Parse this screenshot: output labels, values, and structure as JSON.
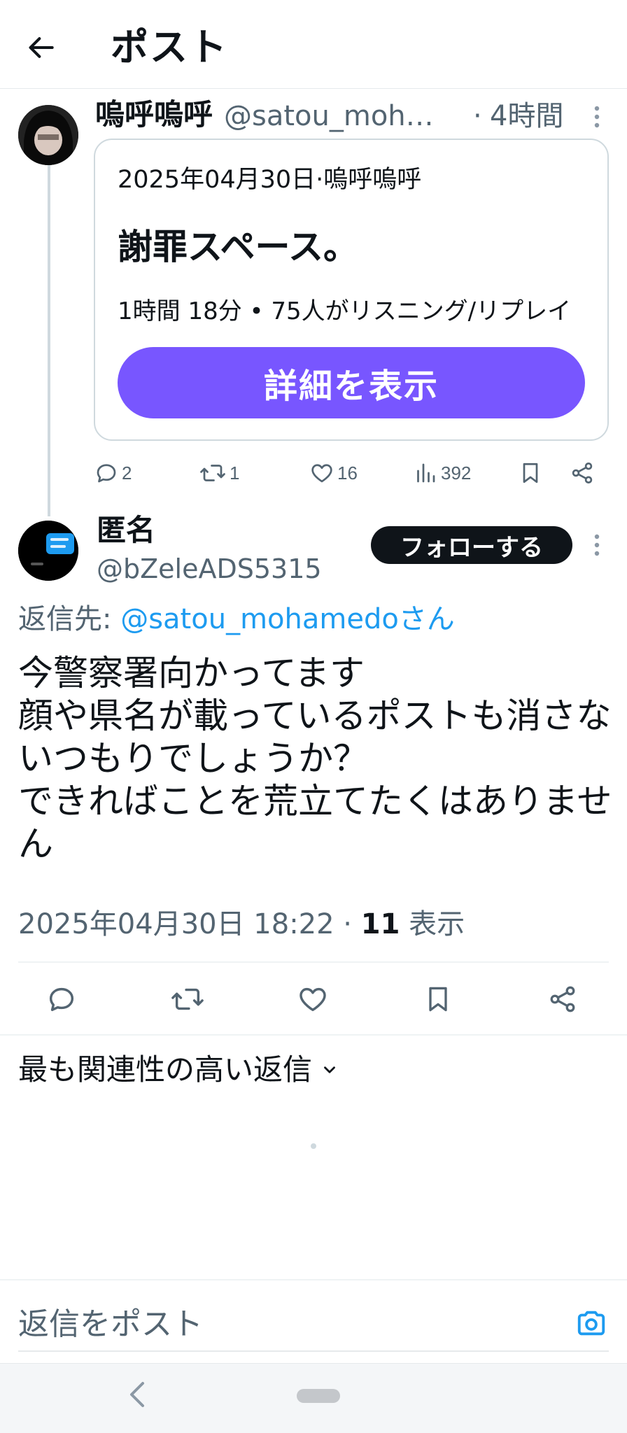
{
  "header": {
    "title": "ポスト"
  },
  "post1": {
    "name": "嗚呼嗚呼",
    "handle": "@satou_mohamedo",
    "separator": "·",
    "time": "4時間",
    "space": {
      "date_host": "2025年04月30日·嗚呼嗚呼",
      "title": "謝罪スペース。",
      "meta": "1時間 18分 • 75人がリスニング/リプレイ",
      "button": "詳細を表示"
    },
    "actions": {
      "replies": "2",
      "reposts": "1",
      "likes": "16",
      "views": "392"
    }
  },
  "post2": {
    "name": "匿名",
    "handle": "@bZeleADS5315",
    "follow_label": "フォローする",
    "reply_prefix": "返信先: ",
    "reply_target": "@satou_mohamedoさん",
    "body": "今警察署向かってます\n顔や県名が載っているポストも消さないつもりでしょうか？\nできればことを荒立てたくはありません",
    "timestamp": "2025年04月30日 18:22 · ",
    "views_count": "11",
    "views_label": " 表示"
  },
  "replies": {
    "sort_label": "最も関連性の高い返信"
  },
  "compose": {
    "placeholder": "返信をポスト"
  },
  "colors": {
    "accent": "#1d9bf0",
    "space_purple": "#7856ff",
    "text": "#0f1419",
    "muted": "#536471"
  }
}
